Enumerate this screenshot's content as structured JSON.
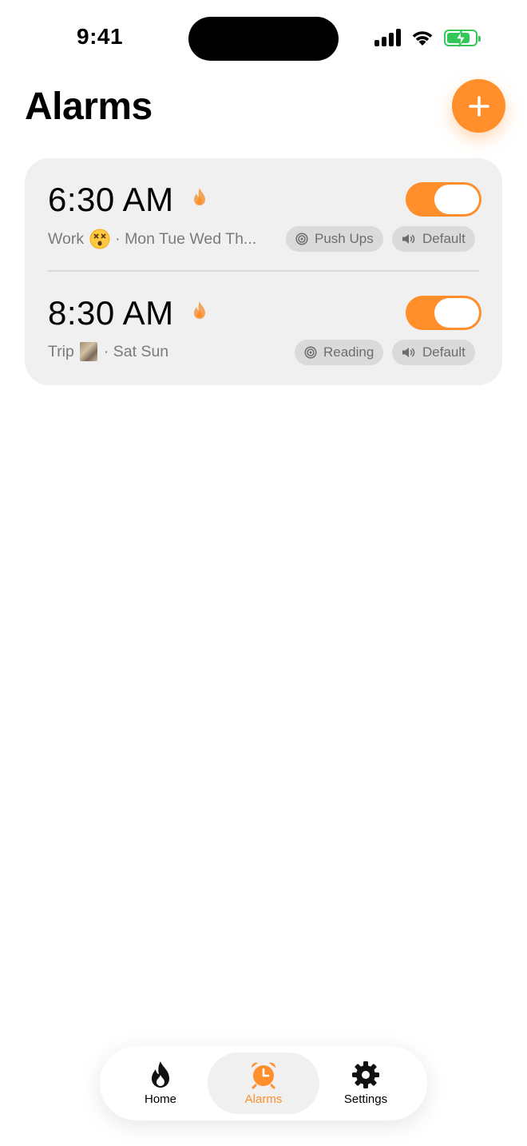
{
  "status_bar": {
    "time": "9:41"
  },
  "header": {
    "title": "Alarms"
  },
  "alarms": [
    {
      "time": "6:30 AM",
      "label": "Work",
      "emoji": "dizzy-face",
      "days": "· Mon Tue Wed Th...",
      "enabled": true,
      "mission": "Push Ups",
      "sound": "Default"
    },
    {
      "time": "8:30 AM",
      "label": "Trip",
      "emoji": "photo",
      "days": "· Sat Sun",
      "enabled": true,
      "mission": "Reading",
      "sound": "Default"
    }
  ],
  "tab_bar": {
    "tabs": [
      {
        "label": "Home",
        "icon": "flame-icon",
        "active": false
      },
      {
        "label": "Alarms",
        "icon": "alarm-clock-icon",
        "active": true
      },
      {
        "label": "Settings",
        "icon": "gear-icon",
        "active": false
      }
    ]
  },
  "colors": {
    "accent": "#ff8e2b",
    "card_background": "#f0f0f0",
    "chip_background": "#dadada",
    "battery": "#34c759"
  }
}
